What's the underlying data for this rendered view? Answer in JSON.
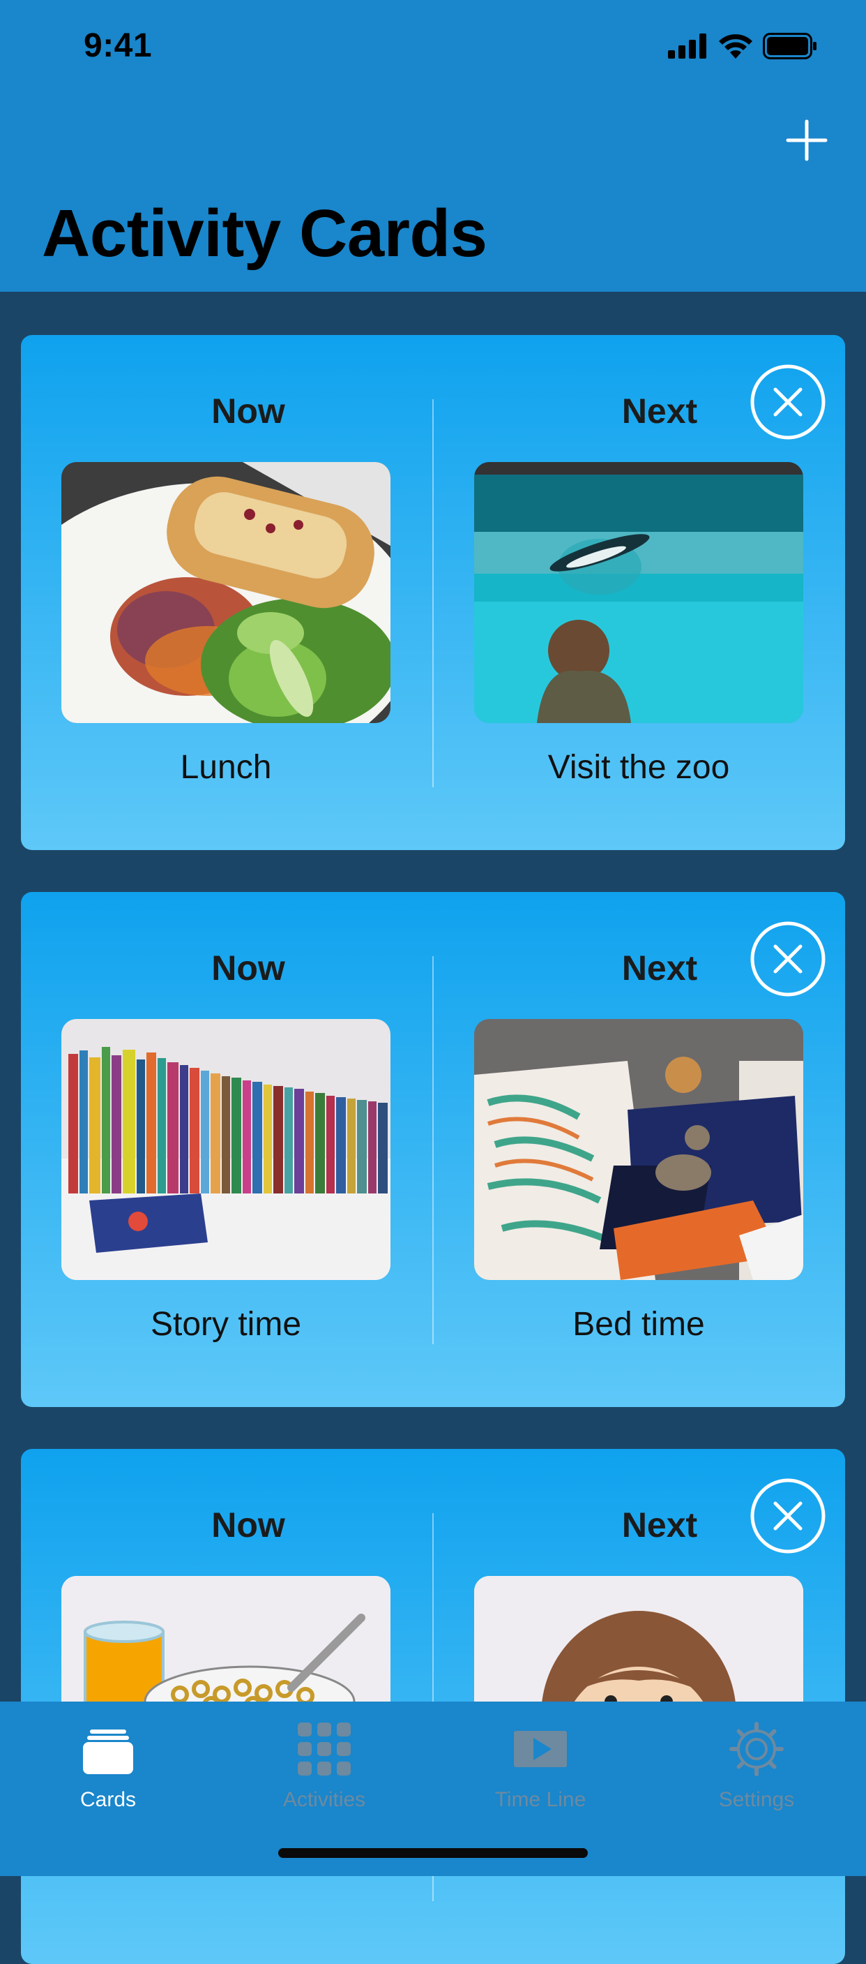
{
  "status_bar": {
    "time": "9:41"
  },
  "header": {
    "title": "Activity Cards",
    "add_icon": "plus-icon"
  },
  "cards": [
    {
      "now_label": "Now",
      "next_label": "Next",
      "now_caption": "Lunch",
      "next_caption": "Visit the zoo"
    },
    {
      "now_label": "Now",
      "next_label": "Next",
      "now_caption": "Story time",
      "next_caption": "Bed time"
    },
    {
      "now_label": "Now",
      "next_label": "Next",
      "now_caption": "",
      "next_caption": ""
    }
  ],
  "tabbar": {
    "tabs": [
      {
        "label": "Cards",
        "icon": "cards-icon",
        "active": true
      },
      {
        "label": "Activities",
        "icon": "grid-icon",
        "active": false
      },
      {
        "label": "Time Line",
        "icon": "play-icon",
        "active": false
      },
      {
        "label": "Settings",
        "icon": "gear-icon",
        "active": false
      }
    ]
  },
  "colors": {
    "header": "#1a86cb",
    "background": "#1b4566",
    "card_top": "#0fa2ee",
    "card_bottom": "#5ec8f8",
    "tab_active": "#ffffff",
    "tab_inactive": "#6d8aa0"
  }
}
